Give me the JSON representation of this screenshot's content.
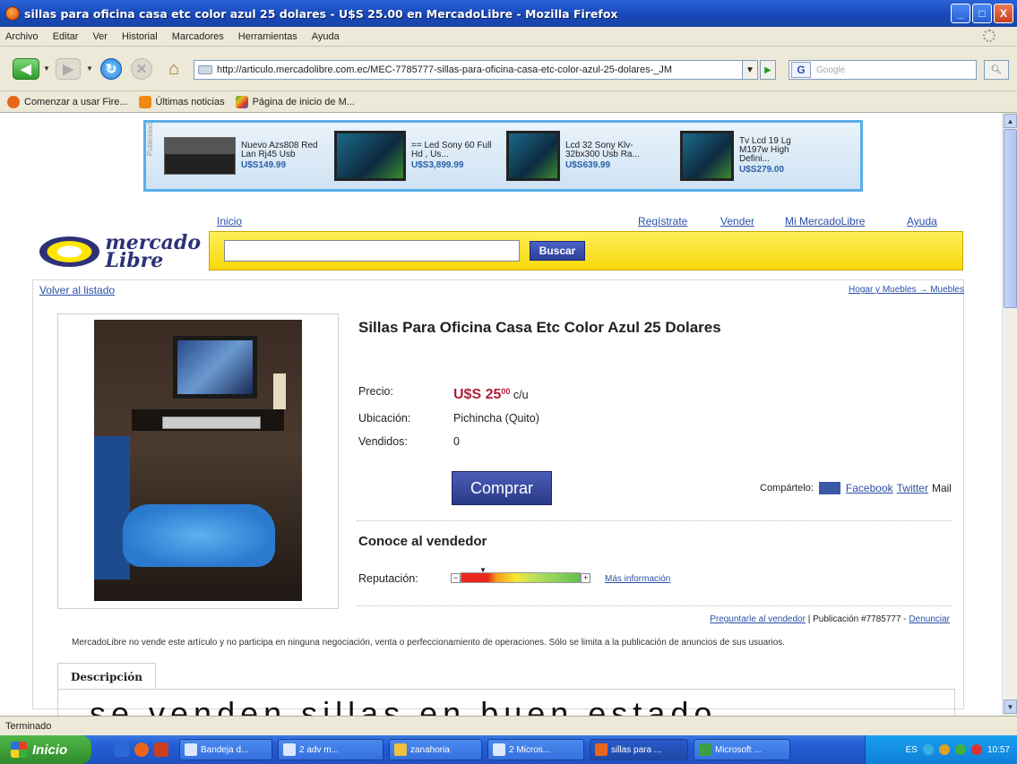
{
  "window": {
    "title": "sillas para oficina casa etc color azul 25 dolares - U$S 25.00 en MercadoLibre - Mozilla Firefox",
    "controls": [
      "_",
      "□",
      "X"
    ]
  },
  "menu": [
    "Archivo",
    "Editar",
    "Ver",
    "Historial",
    "Marcadores",
    "Herramientas",
    "Ayuda"
  ],
  "nav": {
    "url": "http://articulo.mercadolibre.com.ec/MEC-7785777-sillas-para-oficina-casa-etc-color-azul-25-dolares-_JM",
    "search_placeholder": "Google",
    "search_engine_icon": "G"
  },
  "bookmarks": [
    {
      "label": "Comenzar a usar Fire...",
      "icon": "firefox-icon",
      "color": "#e8661c"
    },
    {
      "label": "Últimas noticias",
      "icon": "rss-icon",
      "color": "#f08a10"
    },
    {
      "label": "Página de inicio de M...",
      "icon": "msn-icon",
      "color": "#3a9a3a"
    }
  ],
  "ads": [
    {
      "text": "Nuevo Azs808 Red Lan Rj45 Usb",
      "price": "U$S149.99"
    },
    {
      "text": "== Led Sony 60 Full Hd , Us...",
      "price": "U$S3,899.99"
    },
    {
      "text": "Lcd 32 Sony Klv-32bx300 Usb Ra...",
      "price": "U$S639.99"
    },
    {
      "text": "Tv Lcd 19 Lg M197w High Defini...",
      "price": "U$S279.00"
    }
  ],
  "header": {
    "inicio": "Inicio",
    "registrate": "Regístrate",
    "vender": "Vender",
    "mi_ml": "Mi MercadoLibre",
    "ayuda": "Ayuda",
    "logo_line1": "mercado",
    "logo_line2": "Libre",
    "buscar": "Buscar"
  },
  "listing": {
    "back": "Volver al listado",
    "breadcrumb": "Hogar y Muebles → Muebles",
    "title": "Sillas Para Oficina Casa Etc Color Azul 25 Dolares",
    "precio_label": "Precio:",
    "price_main": "U$S 25",
    "price_cents": "00",
    "price_unit": "c/u",
    "ubicacion_label": "Ubicación:",
    "ubicacion": "Pichincha (Quito)",
    "vendidos_label": "Vendidos:",
    "vendidos": "0",
    "comprar": "Comprar",
    "share_label": "Compártelo:",
    "facebook": "Facebook",
    "twitter": "Twitter",
    "mail": "Mail",
    "conoce": "Conoce al vendedor",
    "reputacion_label": "Reputación:",
    "mas_info": "Más información",
    "preguntar": "Preguntarle al vendedor",
    "publicacion": " | Publicación #7785777 - ",
    "denunciar": "Denunciar",
    "disclaimer": "MercadoLibre no vende este artículo y no participa en ninguna negociación, venta o perfeccionamiento de operaciones. Sólo se limita a la publicación de anuncios de sus usuarios.",
    "tab_descripcion": "Descripción",
    "desc_text": "se venden sillas en buen estado"
  },
  "status": "Terminado",
  "taskbar": {
    "start": "Inicio",
    "tasks": [
      "Bandeja d...",
      "2 adv m...",
      "zanahoria",
      "2 Micros...",
      "sillas para ...",
      "Microsoft ..."
    ],
    "lang": "ES",
    "time": "10:57"
  }
}
